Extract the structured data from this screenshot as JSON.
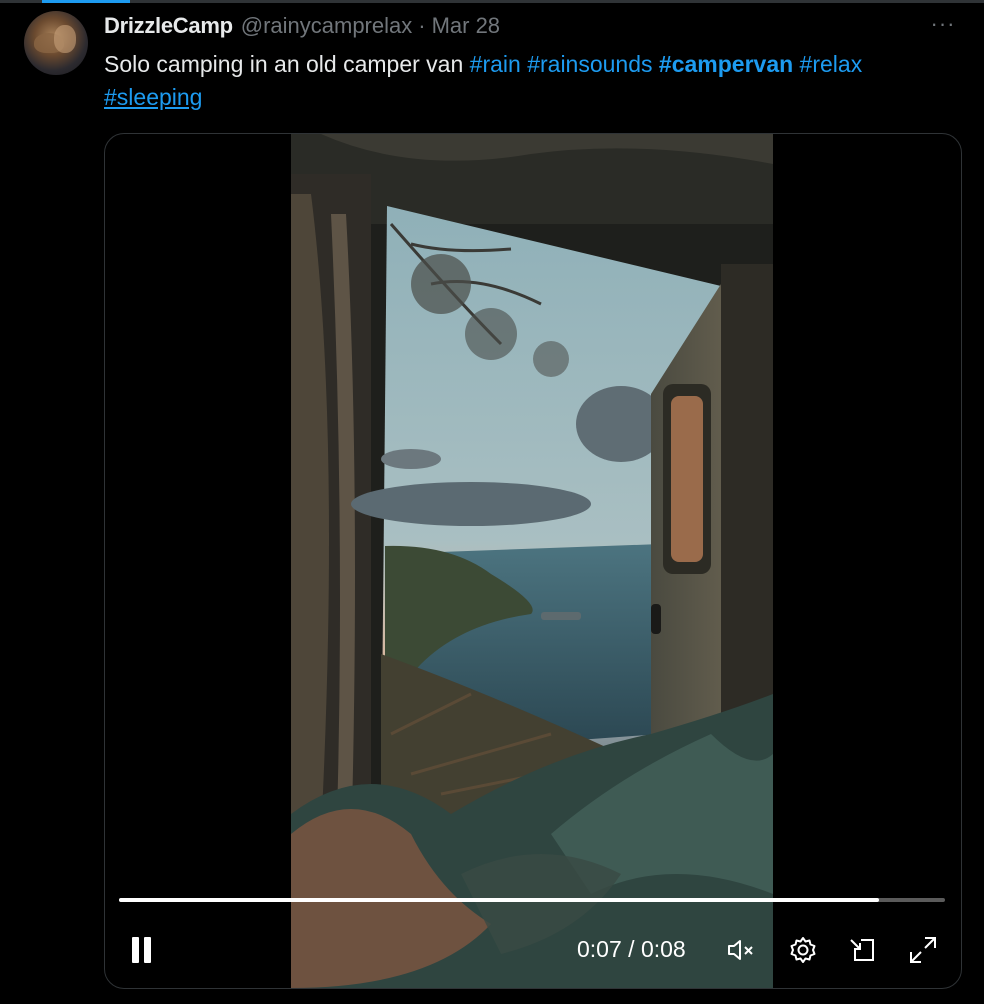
{
  "post": {
    "display_name": "DrizzleCamp",
    "handle": "@rainycamprelax",
    "separator": "·",
    "date": "Mar 28",
    "more": "···",
    "text": "Solo camping in an old camper van",
    "hashtags": [
      "#rain",
      "#rainsounds",
      "#campervan",
      "#relax",
      "#sleeping"
    ]
  },
  "video": {
    "current_time": "0:07",
    "time_separator": "/",
    "duration": "0:08",
    "progress": 0.92,
    "state": "playing"
  },
  "icons": {
    "pause": "pause-icon",
    "mute": "muted-speaker-icon",
    "settings": "gear-icon",
    "popout": "pip-icon",
    "fullscreen": "expand-icon"
  },
  "colors": {
    "accent": "#1d9bf0",
    "muted_text": "#71767b",
    "background": "#000000"
  }
}
